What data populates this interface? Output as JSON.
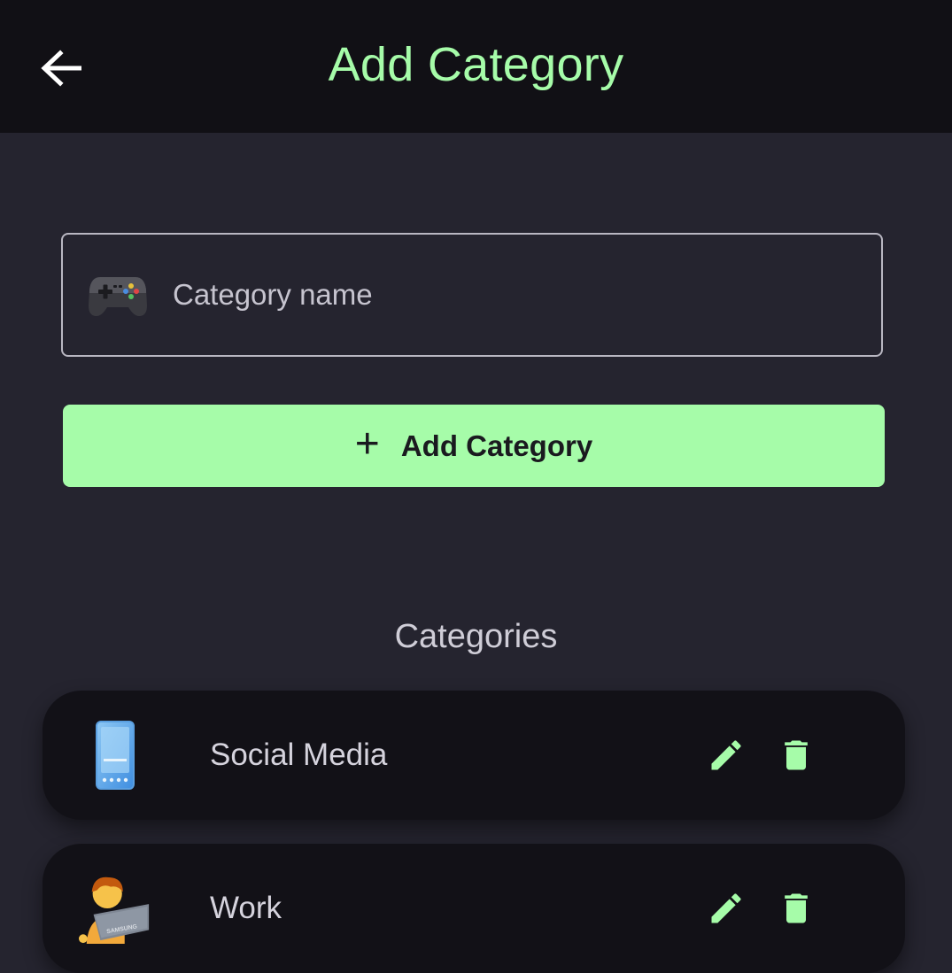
{
  "colors": {
    "accent": "#a6fca9",
    "background": "#25242f",
    "appbar": "#111015",
    "card": "#121117",
    "text_muted": "#d5d3dd"
  },
  "header": {
    "title": "Add Category",
    "back_icon": "arrow-left-icon"
  },
  "form": {
    "icon": "game-controller-icon",
    "placeholder": "Category name",
    "value": "",
    "add_icon": "plus-icon",
    "add_label": "Add Category"
  },
  "categories": {
    "title": "Categories",
    "items": [
      {
        "name": "Social Media",
        "icon": "mobile-phone-icon",
        "edit_icon": "pencil-icon",
        "delete_icon": "trash-icon"
      },
      {
        "name": "Work",
        "icon": "technologist-icon",
        "laptop_brand": "SAMSUNG",
        "edit_icon": "pencil-icon",
        "delete_icon": "trash-icon"
      }
    ]
  }
}
